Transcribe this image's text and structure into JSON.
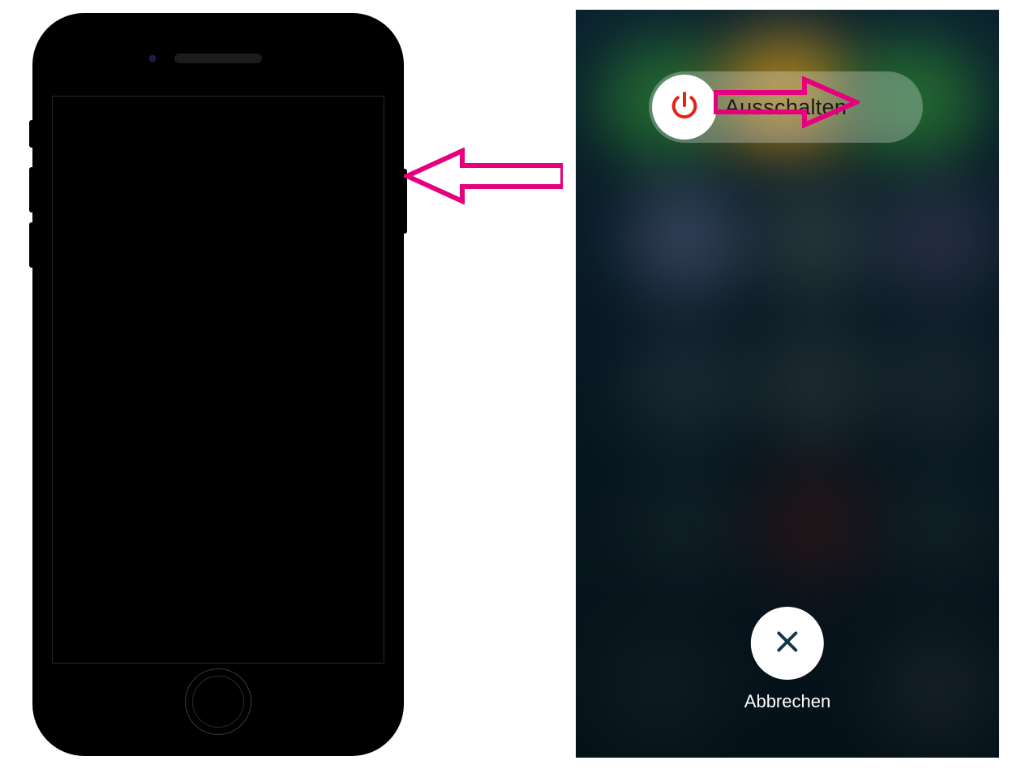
{
  "slider": {
    "label": "Ausschalten",
    "icon": "power-icon",
    "icon_color": "#e2231a"
  },
  "cancel": {
    "label": "Abbrechen",
    "icon": "close-x-icon",
    "icon_color": "#14344a"
  },
  "annotation_arrow_color": "#e6007e"
}
